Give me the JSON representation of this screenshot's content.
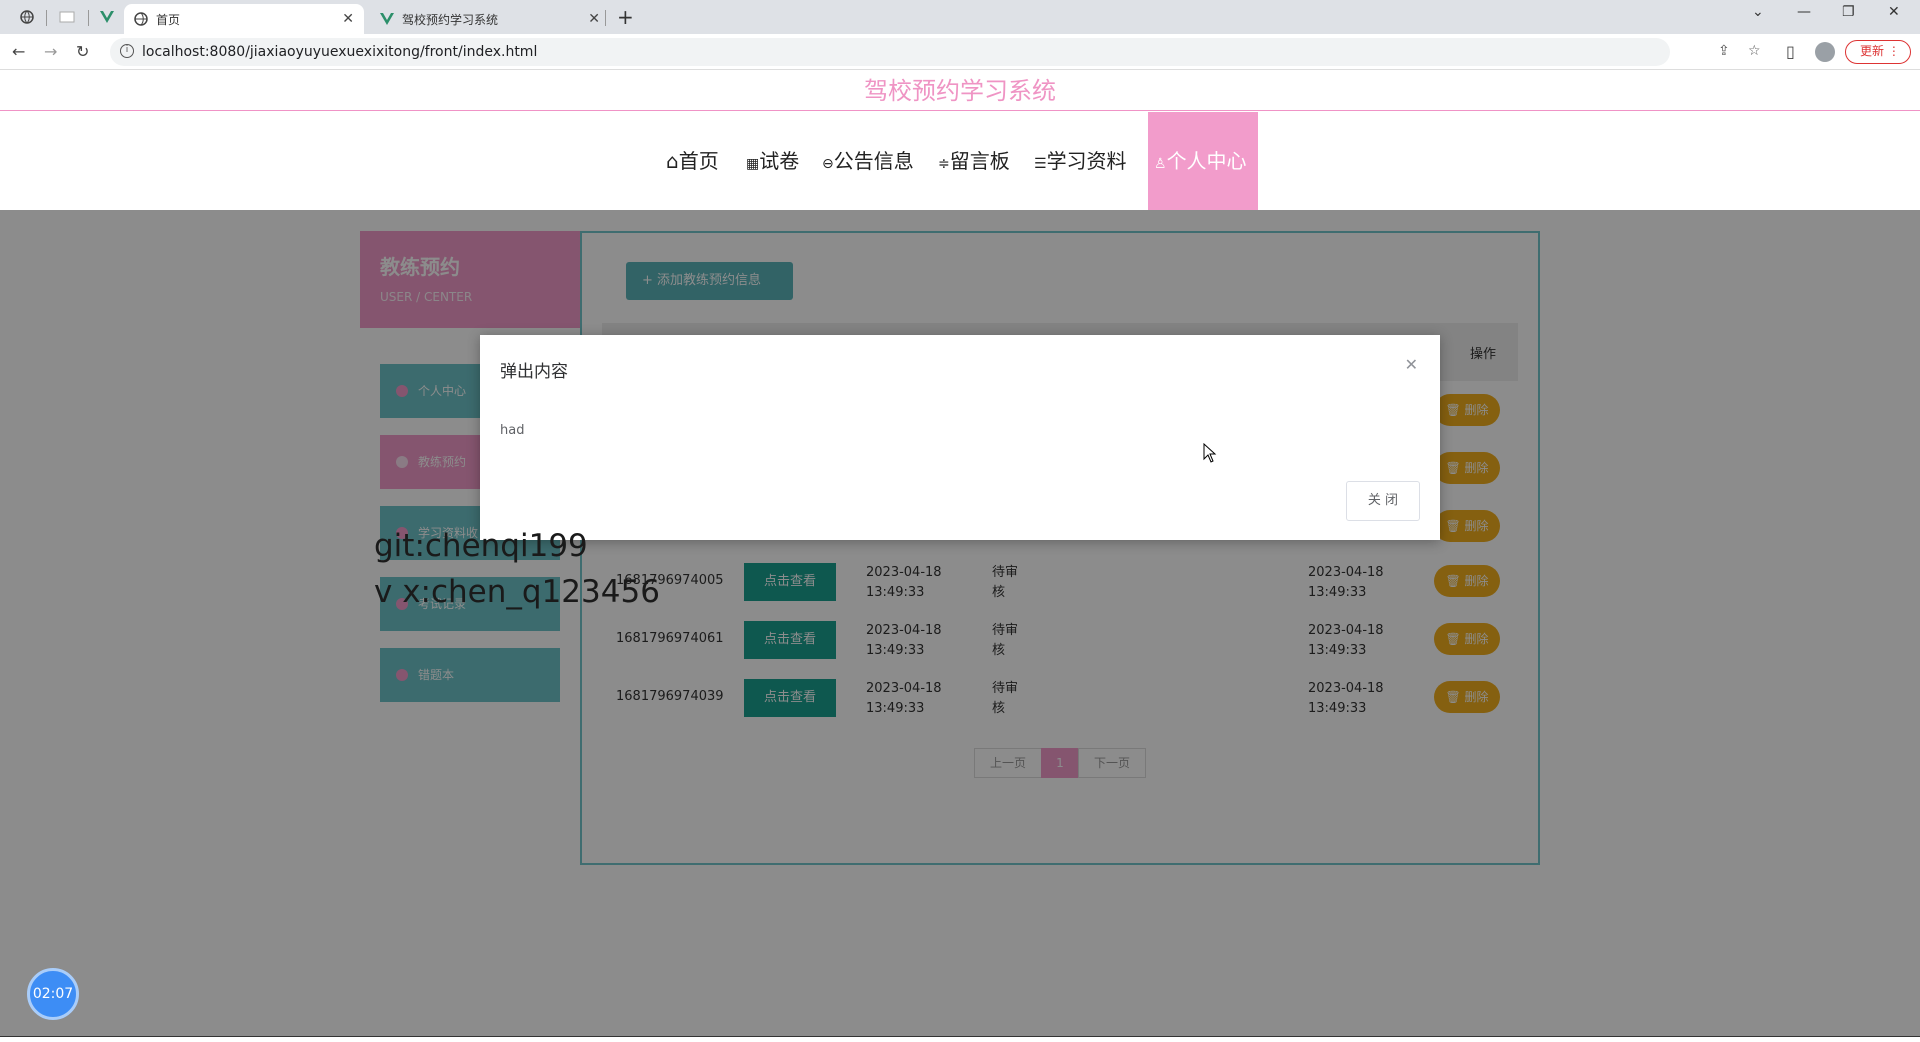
{
  "browser": {
    "tabs": [
      {
        "label": "首页",
        "active": true
      },
      {
        "label": "驾校预约学习系统",
        "active": false
      }
    ],
    "url": "localhost:8080/jiaxiaoyuyuexuexixitong/front/index.html",
    "update_label": "更新"
  },
  "site": {
    "title": "驾校预约学习系统",
    "nav": [
      {
        "icon": "home-icon",
        "label": "首页"
      },
      {
        "icon": "exam-icon",
        "label": "试卷"
      },
      {
        "icon": "notice-icon",
        "label": "公告信息"
      },
      {
        "icon": "message-icon",
        "label": "留言板"
      },
      {
        "icon": "book-icon",
        "label": "学习资料"
      },
      {
        "icon": "user-icon",
        "label": "个人中心",
        "active": true
      }
    ]
  },
  "sidebar": {
    "title": "教练预约",
    "subtitle": "USER / CENTER",
    "items": [
      {
        "label": "个人中心"
      },
      {
        "label": "教练预约",
        "active": true
      },
      {
        "label": "学习资料收"
      },
      {
        "label": "考试记录"
      },
      {
        "label": "错题本"
      }
    ]
  },
  "main": {
    "add_button": "添加教练预约信息",
    "header_action": "操作",
    "view_label": "点击查看",
    "delete_label": "删除",
    "rows": [
      {
        "id": "1681796974005",
        "date1": "2023-04-18",
        "time1": "13:49:33",
        "status1": "待审",
        "status2": "核",
        "date2": "2023-04-18",
        "time2": "13:49:33"
      },
      {
        "id": "1681796974061",
        "date1": "2023-04-18",
        "time1": "13:49:33",
        "status1": "待审",
        "status2": "核",
        "date2": "2023-04-18",
        "time2": "13:49:33"
      },
      {
        "id": "1681796974039",
        "date1": "2023-04-18",
        "time1": "13:49:33",
        "status1": "待审",
        "status2": "核",
        "date2": "2023-04-18",
        "time2": "13:49:33"
      }
    ],
    "pager": {
      "prev": "上一页",
      "current": "1",
      "next": "下一页"
    }
  },
  "dialog": {
    "title": "弹出内容",
    "content": "had",
    "close_label": "关 闭"
  },
  "watermark": {
    "line1": "git:chenqi199",
    "line2": "v x:chen_q123456"
  },
  "timer": "02:07",
  "colors": {
    "pink": "#f29ccb",
    "teal": "#6ec4c9",
    "view_green": "#1aa090",
    "delete_orange": "#f2b01e"
  }
}
